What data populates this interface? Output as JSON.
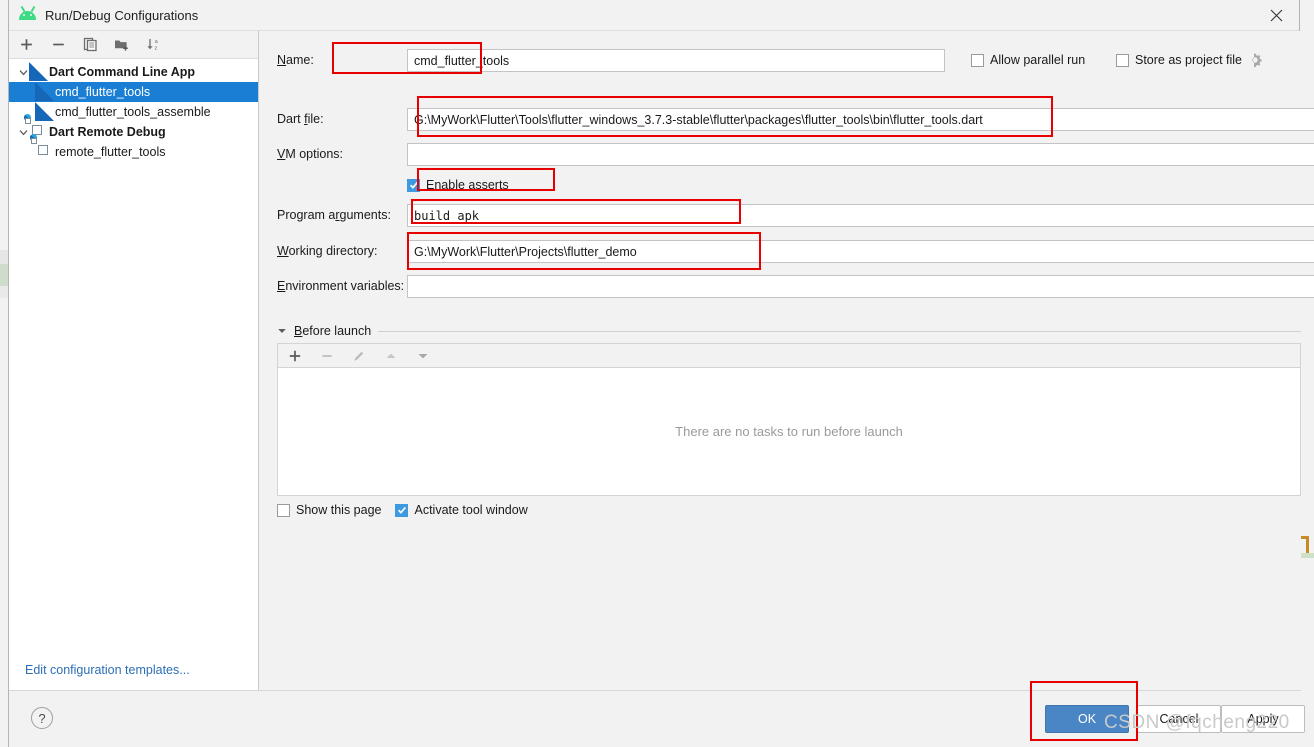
{
  "window": {
    "title": "Run/Debug Configurations",
    "app_icon": "android-icon",
    "close_icon": "close-icon"
  },
  "tree_toolbar": {
    "buttons": [
      {
        "name": "add-configuration-button",
        "icon": "plus-icon",
        "label": "+"
      },
      {
        "name": "remove-configuration-button",
        "icon": "minus-icon",
        "label": "−"
      },
      {
        "name": "copy-configuration-button",
        "icon": "copy-icon",
        "label": ""
      },
      {
        "name": "save-configuration-button",
        "icon": "folder-add-icon",
        "label": ""
      },
      {
        "name": "sort-configurations-button",
        "icon": "sort-alpha-icon",
        "label": ""
      }
    ]
  },
  "tree": {
    "items": [
      {
        "label": "Dart Command Line App",
        "type": "group",
        "icon": "dart-icon",
        "expanded": true,
        "selected": false
      },
      {
        "label": "cmd_flutter_tools",
        "type": "child",
        "icon": "dart-icon",
        "selected": true
      },
      {
        "label": "cmd_flutter_tools_assemble",
        "type": "child",
        "icon": "dart-icon",
        "selected": false
      },
      {
        "label": "Dart Remote Debug",
        "type": "group",
        "icon": "remote-debug-icon",
        "expanded": true,
        "selected": false
      },
      {
        "label": "remote_flutter_tools",
        "type": "child",
        "icon": "remote-debug-icon",
        "selected": false
      }
    ],
    "edit_templates_link": "Edit configuration templates..."
  },
  "form": {
    "name": {
      "label": "Name:",
      "label_mnemonic": "N",
      "value": "cmd_flutter_tools",
      "highlighted": true
    },
    "allow_parallel_run": {
      "label": "Allow parallel run",
      "checked": false
    },
    "store_as_project_file": {
      "label": "Store as project file",
      "checked": false,
      "gear_icon": "gear-icon"
    },
    "dart_file": {
      "label": "Dart file:",
      "value": "G:\\MyWork\\Flutter\\Tools\\flutter_windows_3.7.3-stable\\flutter\\packages\\flutter_tools\\bin\\flutter_tools.dart",
      "browse_icon": "folder-icon",
      "highlighted": true
    },
    "vm_options": {
      "label": "VM options:",
      "value": "",
      "expand_icon": "expand-icon"
    },
    "enable_asserts": {
      "label": "Enable asserts",
      "checked": true,
      "highlighted": true
    },
    "program_arguments": {
      "label": "Program arguments:",
      "value": "build apk",
      "expand_icon": "expand-icon",
      "highlighted": true
    },
    "working_directory": {
      "label": "Working directory:",
      "value": "G:\\MyWork\\Flutter\\Projects\\flutter_demo",
      "browse_icon": "folder-icon",
      "highlighted": true
    },
    "environment_variables": {
      "label": "Environment variables:",
      "value": "",
      "edit_icon": "list-edit-icon"
    }
  },
  "before_launch": {
    "title": "Before launch",
    "collapse_icon": "chevron-down-icon",
    "toolbar": [
      {
        "name": "add-task-button",
        "icon": "plus-icon"
      },
      {
        "name": "remove-task-button",
        "icon": "minus-icon"
      },
      {
        "name": "edit-task-button",
        "icon": "pencil-icon"
      },
      {
        "name": "move-task-up-button",
        "icon": "chevron-up-icon"
      },
      {
        "name": "move-task-down-button",
        "icon": "chevron-down-icon"
      }
    ],
    "empty_text": "There are no tasks to run before launch",
    "show_this_page": {
      "label": "Show this page",
      "checked": false
    },
    "activate_tool_window": {
      "label": "Activate tool window",
      "checked": true
    }
  },
  "footer": {
    "help_label": "?",
    "ok_label": "OK",
    "cancel_label": "Cancel",
    "apply_label": "Apply",
    "ok_highlighted": true
  },
  "watermark": "CSDN @fqcheng220",
  "colors": {
    "accent": "#4a86c5",
    "selection": "#1a7fd4",
    "highlight": "#e60000",
    "link": "#2c6fb5",
    "checkbox_checked": "#3d9ae0",
    "window_bg": "#f2f2f2",
    "panel_bg": "#ffffff"
  }
}
